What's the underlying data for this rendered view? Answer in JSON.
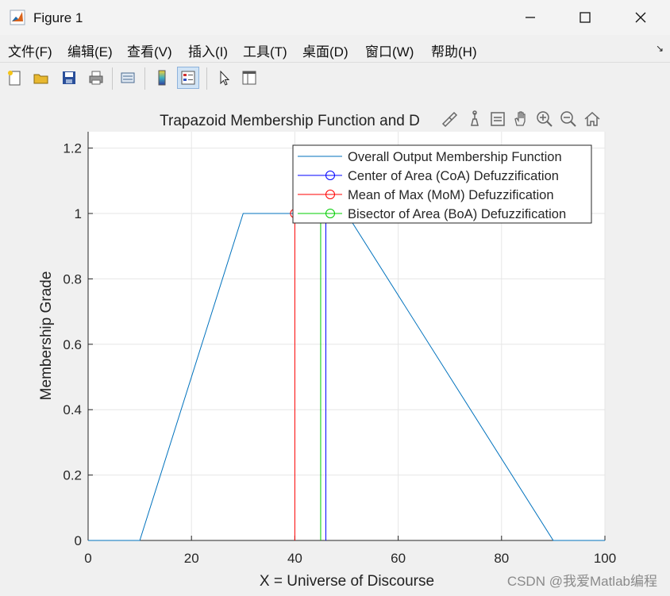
{
  "window": {
    "title": "Figure 1"
  },
  "menu": [
    "文件(F)",
    "编辑(E)",
    "查看(V)",
    "插入(I)",
    "工具(T)",
    "桌面(D)",
    "窗口(W)",
    "帮助(H)"
  ],
  "toolbar_icons": [
    "new-figure-icon",
    "open-file-icon",
    "save-icon",
    "print-icon",
    "link-plot-icon",
    "colorbar-icon",
    "legend-icon",
    "edit-plot-arrow-icon",
    "property-inspector-icon"
  ],
  "axes_toolbar_icons": [
    "brush-icon",
    "data-tips-icon",
    "pan-icon",
    "zoom-in-icon",
    "zoom-out-icon",
    "restore-view-icon"
  ],
  "watermark": "CSDN @我爱Matlab编程",
  "colors": {
    "output": "#0072bd",
    "coa": "#0000ff",
    "mom": "#ff0000",
    "boa": "#00cc00"
  },
  "chart_data": {
    "type": "line",
    "title": "Trapazoid Membership Function and D",
    "xlabel": "X = Universe of Discourse",
    "ylabel": "Membership Grade",
    "xlim": [
      0,
      100
    ],
    "ylim": [
      0,
      1.25
    ],
    "xticks": [
      0,
      20,
      40,
      60,
      80,
      100
    ],
    "yticks": [
      0,
      0.2,
      0.4,
      0.6,
      0.8,
      1,
      1.2
    ],
    "grid": true,
    "legend_position": "top-right",
    "series": [
      {
        "name": "Overall Output Membership Function",
        "x": [
          0,
          10,
          30,
          50,
          90,
          100
        ],
        "y": [
          0,
          0,
          1,
          1,
          0,
          0
        ],
        "marker": "none"
      },
      {
        "name": "Center of Area (CoA) Defuzzification",
        "x": [
          46,
          46
        ],
        "y": [
          0,
          1
        ],
        "marker": "circle"
      },
      {
        "name": "Mean of Max (MoM) Defuzzification",
        "x": [
          40,
          40
        ],
        "y": [
          0,
          1
        ],
        "marker": "circle"
      },
      {
        "name": "Bisector of Area (BoA) Defuzzification",
        "x": [
          45,
          45
        ],
        "y": [
          0,
          1
        ],
        "marker": "circle"
      }
    ]
  }
}
